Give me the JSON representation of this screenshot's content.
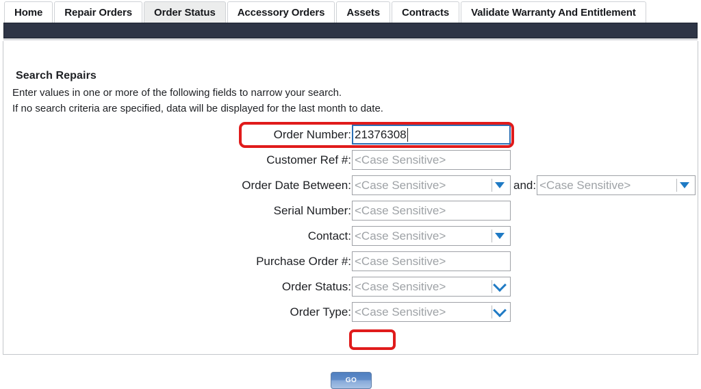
{
  "tabs": [
    {
      "label": "Home",
      "active": false
    },
    {
      "label": "Repair Orders",
      "active": false
    },
    {
      "label": "Order Status",
      "active": true
    },
    {
      "label": "Accessory Orders",
      "active": false
    },
    {
      "label": "Assets",
      "active": false
    },
    {
      "label": "Contracts",
      "active": false
    },
    {
      "label": "Validate Warranty And Entitlement",
      "active": false
    }
  ],
  "page": {
    "heading": "Search Repairs",
    "instruction_line_1": "Enter values in one or more of the following fields to narrow your search.",
    "instruction_line_2": "If no search criteria are specified, data will be displayed for the last month to date.",
    "and_label": "and:"
  },
  "fields": {
    "order_number": {
      "label": "Order Number:",
      "value": "21376308",
      "placeholder": "<Case Sensitive>",
      "focused": true,
      "highlighted": true
    },
    "customer_ref": {
      "label": "Customer Ref #:",
      "value": "",
      "placeholder": "<Case Sensitive>"
    },
    "order_date_between": {
      "label": "Order Date Between:",
      "value": "",
      "placeholder": "<Case Sensitive>"
    },
    "order_date_and": {
      "value": "",
      "placeholder": "<Case Sensitive>"
    },
    "serial_number": {
      "label": "Serial Number:",
      "value": "",
      "placeholder": "<Case Sensitive>"
    },
    "contact": {
      "label": "Contact:",
      "value": "",
      "placeholder": "<Case Sensitive>"
    },
    "purchase_order": {
      "label": "Purchase Order #:",
      "value": "",
      "placeholder": "<Case Sensitive>"
    },
    "order_status": {
      "label": "Order Status:",
      "value": "",
      "placeholder": "<Case Sensitive>"
    },
    "order_type": {
      "label": "Order Type:",
      "value": "",
      "placeholder": "<Case Sensitive>"
    }
  },
  "buttons": {
    "go": "GO"
  },
  "colors": {
    "nav_band": "#2e3546",
    "annotation": "#e01b1b",
    "focus_border": "#2a6fb5",
    "dropdown_arrow": "#1f7ac4",
    "placeholder_text": "#9ea2a6",
    "active_tab_bg": "#eceded"
  }
}
